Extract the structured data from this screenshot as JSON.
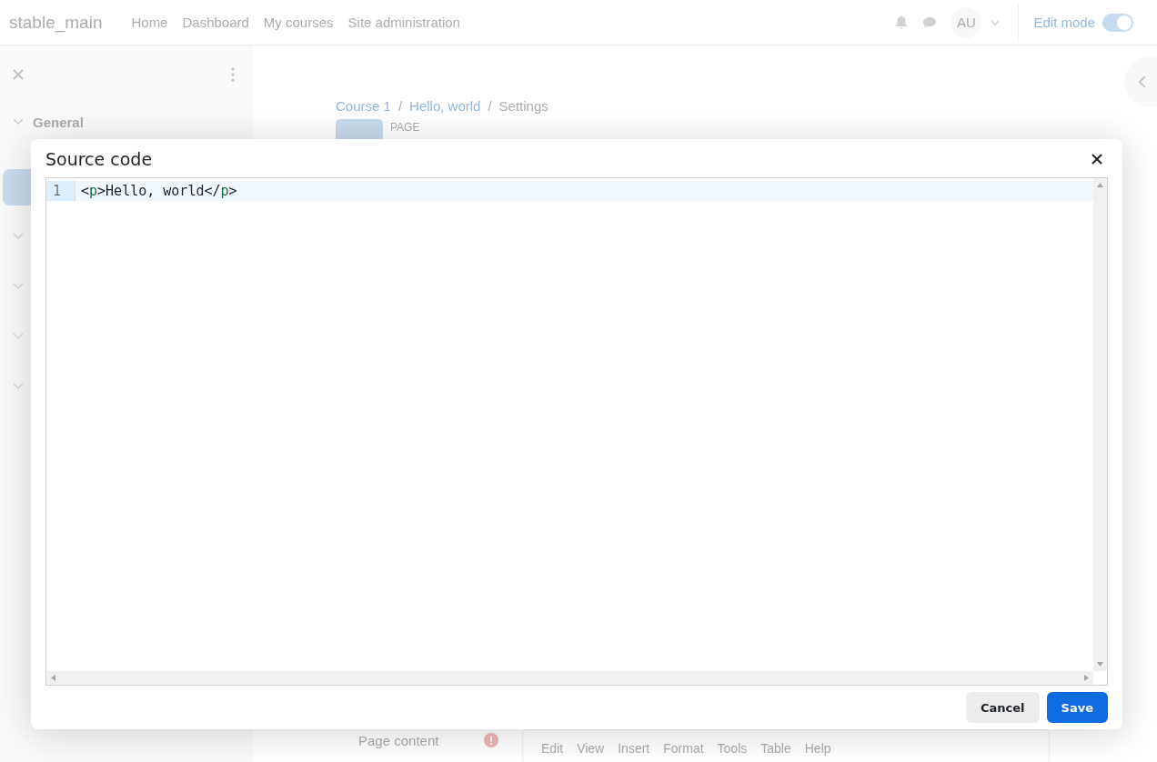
{
  "navbar": {
    "brand": "stable_main",
    "links": [
      "Home",
      "Dashboard",
      "My courses",
      "Site administration"
    ],
    "avatar": "AU",
    "edit_mode": {
      "label": "Edit mode",
      "on": true
    }
  },
  "sidebar": {
    "section": "General"
  },
  "breadcrumb_separator": "/",
  "breadcrumb": [
    {
      "label": "Course 1",
      "link": true
    },
    {
      "label": "Hello, world",
      "link": true
    },
    {
      "label": "Settings",
      "link": false
    }
  ],
  "activity_type": "PAGE",
  "form": {
    "label": "Page content",
    "required": true,
    "editor_menu": [
      "Edit",
      "View",
      "Insert",
      "Format",
      "Tools",
      "Table",
      "Help"
    ]
  },
  "modal": {
    "title": "Source code",
    "lines": [
      {
        "number": "1",
        "tokens": [
          {
            "text": "<",
            "kind": "plain"
          },
          {
            "text": "p",
            "kind": "tag"
          },
          {
            "text": ">Hello, world</",
            "kind": "plain"
          },
          {
            "text": "p",
            "kind": "tag"
          },
          {
            "text": ">",
            "kind": "plain"
          }
        ]
      }
    ],
    "buttons": [
      {
        "label": "Cancel",
        "kind": "secondary"
      },
      {
        "label": "Save",
        "kind": "primary"
      }
    ]
  }
}
